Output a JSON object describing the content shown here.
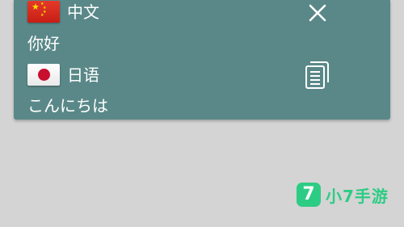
{
  "translation": {
    "source": {
      "language": "中文",
      "flag": "china-flag-icon",
      "text": "你好"
    },
    "target": {
      "language": "日语",
      "flag": "japan-flag-icon",
      "text": "こんにちは"
    }
  },
  "actions": {
    "close_icon": "close-icon",
    "copy_icon": "copy-icon"
  },
  "watermark": {
    "icon_glyph": "7",
    "text": "小7手游"
  },
  "colors": {
    "card_background": "#5a8888",
    "page_background": "#d4d4d4",
    "watermark": "#2dcc84"
  }
}
